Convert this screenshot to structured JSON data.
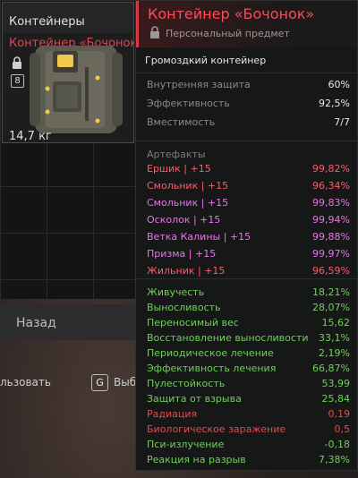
{
  "inventory": {
    "slot_title": "Контейнеры",
    "item_name": "Контейнер «Бочонок»",
    "badge": "8",
    "weight": "14,7 кг",
    "back_label": "Назад",
    "use_label": "льзовать",
    "key_hint": "G",
    "throw_label": "Выб"
  },
  "tooltip": {
    "title": "Контейнер «Бочонок»",
    "subtitle": "Персональный предмет",
    "description": "Громоздкий контейнер",
    "props": [
      {
        "label": "Внутренняя защита",
        "value": "60%"
      },
      {
        "label": "Эффективность",
        "value": "92,5%"
      },
      {
        "label": "Вместимость",
        "value": "7/7"
      }
    ],
    "artifacts_label": "Артефакты",
    "artifacts": [
      {
        "name": "Ершик | +15",
        "value": "99,82%",
        "color": "#ff5c6a"
      },
      {
        "name": "Смольник | +15",
        "value": "96,34%",
        "color": "#ff5c6a"
      },
      {
        "name": "Смольник | +15",
        "value": "99,83%",
        "color": "#e676e6"
      },
      {
        "name": "Осколок | +15",
        "value": "99,94%",
        "color": "#e676e6"
      },
      {
        "name": "Ветка Калины | +15",
        "value": "99,88%",
        "color": "#e676e6"
      },
      {
        "name": "Призма | +15",
        "value": "99,97%",
        "color": "#e676e6"
      },
      {
        "name": "Жильник | +15",
        "value": "96,59%",
        "color": "#ff5c6a"
      }
    ],
    "stats": [
      {
        "name": "Живучесть",
        "value": "18,21%",
        "color": "#6fd05a"
      },
      {
        "name": "Выносливость",
        "value": "28,07%",
        "color": "#6fd05a"
      },
      {
        "name": "Переносимый вес",
        "value": "15,62",
        "color": "#6fd05a"
      },
      {
        "name": "Восстановление выносливости",
        "value": "33,1%",
        "color": "#6fd05a"
      },
      {
        "name": "Периодическое лечение",
        "value": "2,19%",
        "color": "#6fd05a"
      },
      {
        "name": "Эффективность лечения",
        "value": "66,87%",
        "color": "#6fd05a"
      },
      {
        "name": "Пулестойкость",
        "value": "53,99",
        "color": "#6fd05a"
      },
      {
        "name": "Защита от взрыва",
        "value": "25,84",
        "color": "#6fd05a"
      },
      {
        "name": "Радиация",
        "value": "0,19",
        "color": "#e04c4c"
      },
      {
        "name": "Биологическое заражение",
        "value": "0,5",
        "color": "#e04c4c"
      },
      {
        "name": "Пси-излучение",
        "value": "-0,18",
        "color": "#6fd05a"
      },
      {
        "name": "Реакция на разрыв",
        "value": "7,38%",
        "color": "#6fd05a"
      }
    ]
  }
}
